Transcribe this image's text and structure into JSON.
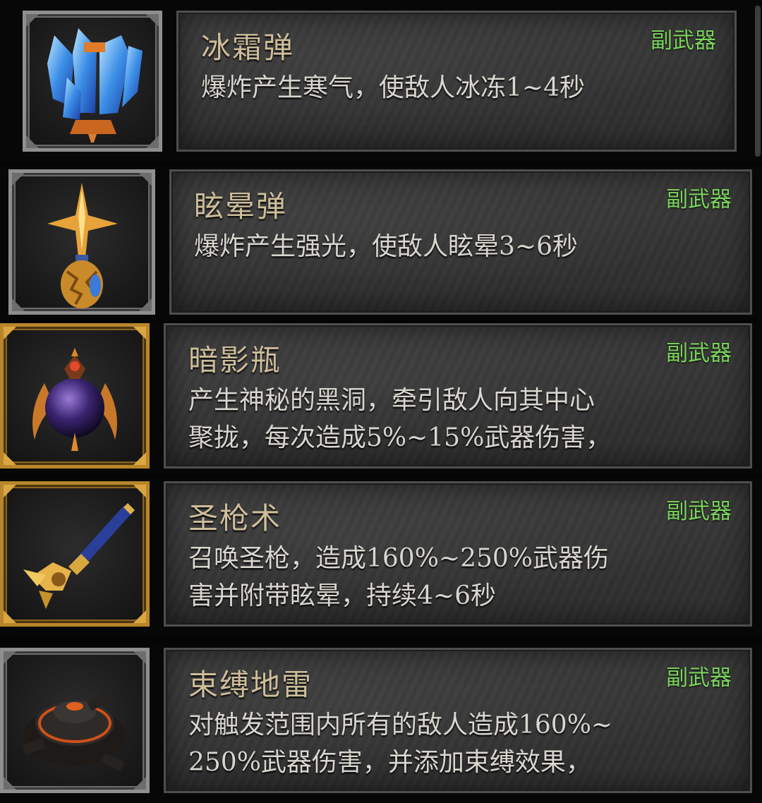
{
  "category_label": "副武器",
  "items": [
    {
      "name": "冰霜弹",
      "tag": "副武器",
      "desc": [
        "爆炸产生寒气，使敌人冰冻1~4秒"
      ],
      "icon": "ice-crystal-icon",
      "frame": "silver"
    },
    {
      "name": "眩晕弹",
      "tag": "副武器",
      "desc": [
        "爆炸产生强光，使敌人眩晕3~6秒"
      ],
      "icon": "star-vial-icon",
      "frame": "silver"
    },
    {
      "name": "暗影瓶",
      "tag": "副武器",
      "desc": [
        "产生神秘的黑洞，牵引敌人向其中心",
        "聚拢，每次造成5%~15%武器伤害，"
      ],
      "icon": "shadow-orb-icon",
      "frame": "gold"
    },
    {
      "name": "圣枪术",
      "tag": "副武器",
      "desc": [
        "召唤圣枪，造成160%~250%武器伤",
        "害并附带眩晕，持续4~6秒"
      ],
      "icon": "holy-spear-icon",
      "frame": "gold"
    },
    {
      "name": "束缚地雷",
      "tag": "副武器",
      "desc": [
        "对触发范围内所有的敌人造成160%~",
        "250%武器伤害，并添加束缚效果，"
      ],
      "icon": "bind-mine-icon",
      "frame": "silver"
    }
  ],
  "colors": {
    "name": "#cdbd9a",
    "tag": "#7bd35c",
    "desc": "#d9d6cf",
    "gold_frame": "#b8862a",
    "silver_frame": "#8f8f8f"
  }
}
